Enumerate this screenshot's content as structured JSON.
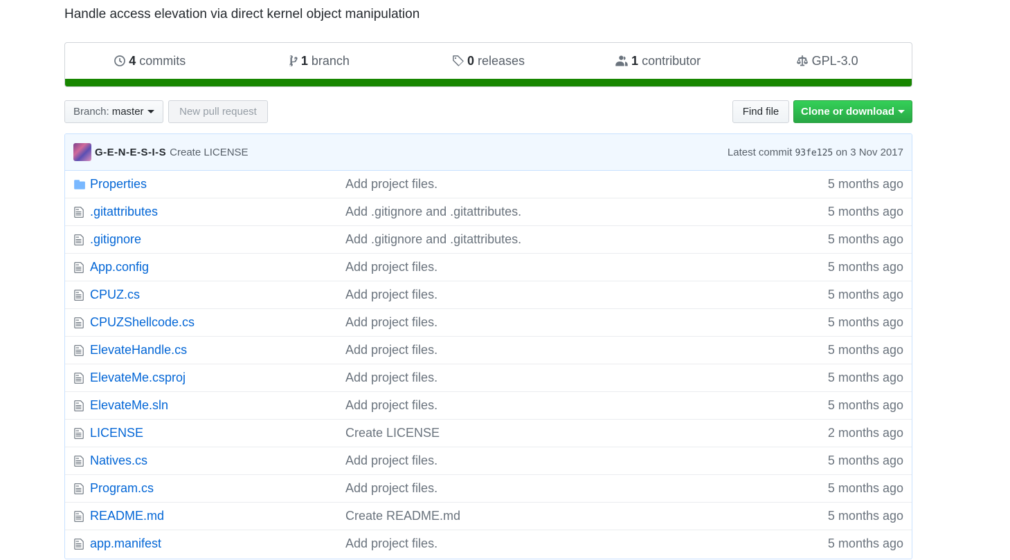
{
  "repo": {
    "description": "Handle access elevation via direct kernel object manipulation"
  },
  "summary": {
    "commits_count": "4",
    "commits_label": "commits",
    "branches_count": "1",
    "branches_label": "branch",
    "releases_count": "0",
    "releases_label": "releases",
    "contributors_count": "1",
    "contributors_label": "contributor",
    "license": "GPL-3.0",
    "language_color": "#178600"
  },
  "toolbar": {
    "branch_label": "Branch:",
    "branch_value": "master",
    "new_pr": "New pull request",
    "find_file": "Find file",
    "clone": "Clone or download"
  },
  "commit": {
    "author": "G-E-N-E-S-I-S",
    "message": "Create LICENSE",
    "latest_label": "Latest commit",
    "sha": "93fe125",
    "date": "on 3 Nov 2017"
  },
  "files": [
    {
      "type": "dir",
      "name": "Properties",
      "message": "Add project files.",
      "age": "5 months ago"
    },
    {
      "type": "file",
      "name": ".gitattributes",
      "message": "Add .gitignore and .gitattributes.",
      "age": "5 months ago"
    },
    {
      "type": "file",
      "name": ".gitignore",
      "message": "Add .gitignore and .gitattributes.",
      "age": "5 months ago"
    },
    {
      "type": "file",
      "name": "App.config",
      "message": "Add project files.",
      "age": "5 months ago"
    },
    {
      "type": "file",
      "name": "CPUZ.cs",
      "message": "Add project files.",
      "age": "5 months ago"
    },
    {
      "type": "file",
      "name": "CPUZShellcode.cs",
      "message": "Add project files.",
      "age": "5 months ago"
    },
    {
      "type": "file",
      "name": "ElevateHandle.cs",
      "message": "Add project files.",
      "age": "5 months ago"
    },
    {
      "type": "file",
      "name": "ElevateMe.csproj",
      "message": "Add project files.",
      "age": "5 months ago"
    },
    {
      "type": "file",
      "name": "ElevateMe.sln",
      "message": "Add project files.",
      "age": "5 months ago"
    },
    {
      "type": "file",
      "name": "LICENSE",
      "message": "Create LICENSE",
      "age": "2 months ago"
    },
    {
      "type": "file",
      "name": "Natives.cs",
      "message": "Add project files.",
      "age": "5 months ago"
    },
    {
      "type": "file",
      "name": "Program.cs",
      "message": "Add project files.",
      "age": "5 months ago"
    },
    {
      "type": "file",
      "name": "README.md",
      "message": "Create README.md",
      "age": "5 months ago"
    },
    {
      "type": "file",
      "name": "app.manifest",
      "message": "Add project files.",
      "age": "5 months ago"
    }
  ]
}
